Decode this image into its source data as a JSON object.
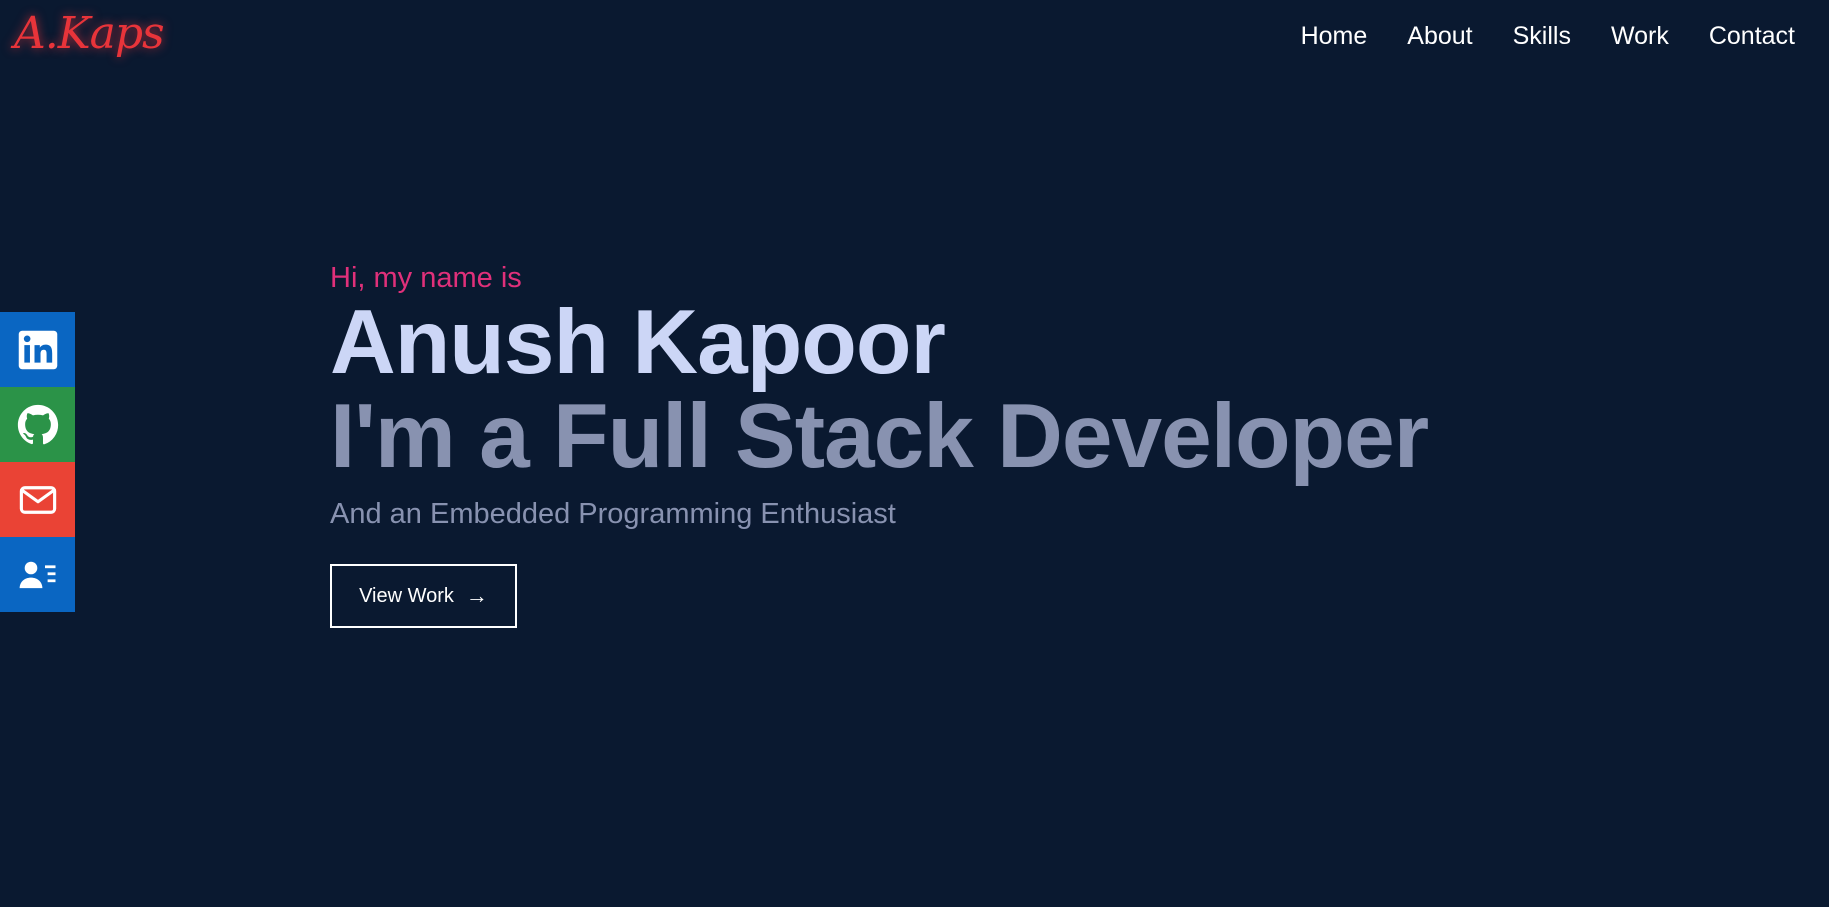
{
  "header": {
    "logo": "A.Kaps",
    "nav": [
      "Home",
      "About",
      "Skills",
      "Work",
      "Contact"
    ]
  },
  "social": [
    {
      "icon": "linkedin-icon",
      "color": "#0a66c2"
    },
    {
      "icon": "github-icon",
      "color": "#2b9348"
    },
    {
      "icon": "mail-icon",
      "color": "#ea4335"
    },
    {
      "icon": "contact-card-icon",
      "color": "#0a66c2"
    }
  ],
  "hero": {
    "greeting": "Hi, my name is",
    "name": "Anush Kapoor",
    "role": "I'm a Full Stack Developer",
    "subtitle": "And an Embedded Programming Enthusiast",
    "button_label": "View Work",
    "button_icon": "arrow-right-icon"
  },
  "colors": {
    "background": "#0a1930",
    "accent": "#e0307a",
    "logo": "#e8343a",
    "name": "#ccd6f6",
    "muted": "#8892b0"
  }
}
